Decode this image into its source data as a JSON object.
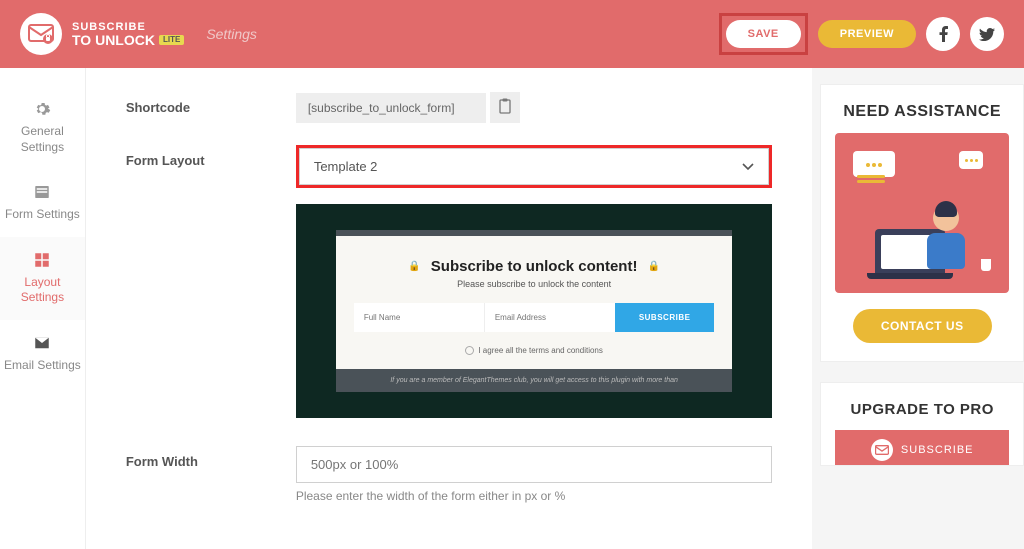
{
  "header": {
    "brand_line1": "SUBSCRIBE",
    "brand_line2": "TO UNLOCK",
    "lite": "LITE",
    "settings": "Settings",
    "save": "SAVE",
    "preview": "PREVIEW"
  },
  "sidebar": {
    "items": [
      {
        "label": "General Settings"
      },
      {
        "label": "Form Settings"
      },
      {
        "label": "Layout Settings"
      },
      {
        "label": "Email Settings"
      }
    ]
  },
  "main": {
    "shortcode_label": "Shortcode",
    "shortcode_value": "[subscribe_to_unlock_form]",
    "form_layout_label": "Form Layout",
    "template_selected": "Template 2",
    "preview": {
      "title": "Subscribe to unlock content!",
      "subtitle": "Please subscribe to unlock the content",
      "fullname_ph": "Full Name",
      "email_ph": "Email Address",
      "subscribe_btn": "SUBSCRIBE",
      "agree": "I agree all the terms and conditions",
      "footer": "If you are a member of ElegantThemes club, you will get access to this plugin with more than"
    },
    "form_width_label": "Form Width",
    "form_width_ph": "500px or 100%",
    "form_width_help": "Please enter the width of the form either in px or %"
  },
  "right": {
    "assist_title": "NEED ASSISTANCE",
    "contact_btn": "CONTACT US",
    "upgrade_title": "UPGRADE TO PRO",
    "upgrade_brand": "SUBSCRIBE"
  }
}
